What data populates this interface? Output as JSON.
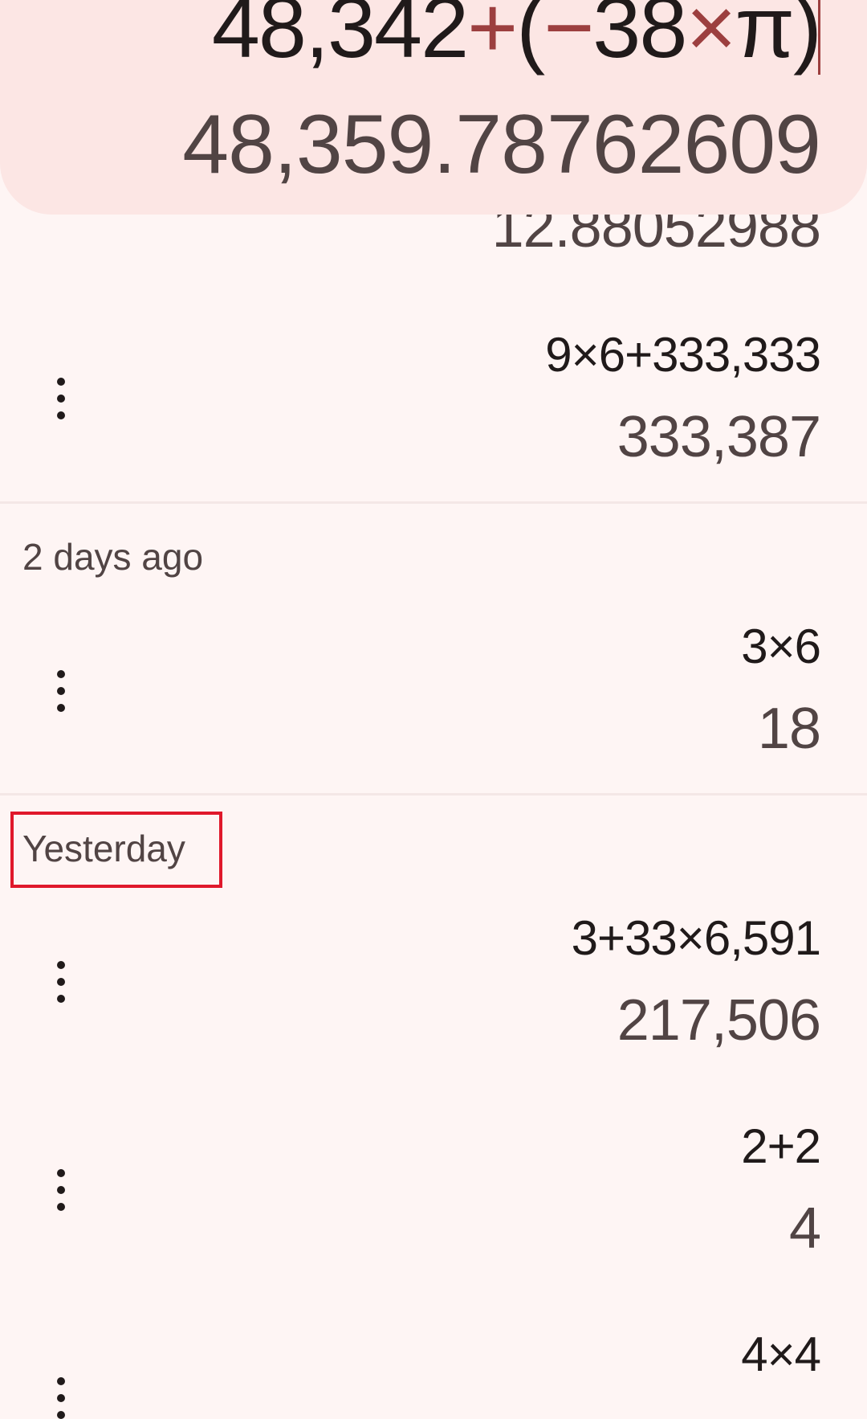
{
  "display": {
    "formula_parts": [
      "48,342",
      "+",
      "(",
      "−",
      "38",
      "×",
      "π)"
    ],
    "preview_result": "48,359.78762609"
  },
  "history": {
    "partial_result": "12.88052988",
    "groups": [
      {
        "label": "",
        "items": [
          {
            "expression": "9×6+333,333",
            "result": "333,387"
          }
        ]
      },
      {
        "label": "2 days ago",
        "items": [
          {
            "expression": "3×6",
            "result": "18"
          }
        ]
      },
      {
        "label": "Yesterday",
        "items": [
          {
            "expression": "3+33×6,591",
            "result": "217,506"
          },
          {
            "expression": "2+2",
            "result": "4"
          },
          {
            "expression": "4×4",
            "result": ""
          }
        ]
      }
    ]
  },
  "icons": {
    "item_menu": "more-vert-icon"
  },
  "colors": {
    "background": "#FEF5F4",
    "display_card": "#FCE6E4",
    "operator_accent": "#9C3F3F",
    "highlight_box": "#E0182B"
  }
}
